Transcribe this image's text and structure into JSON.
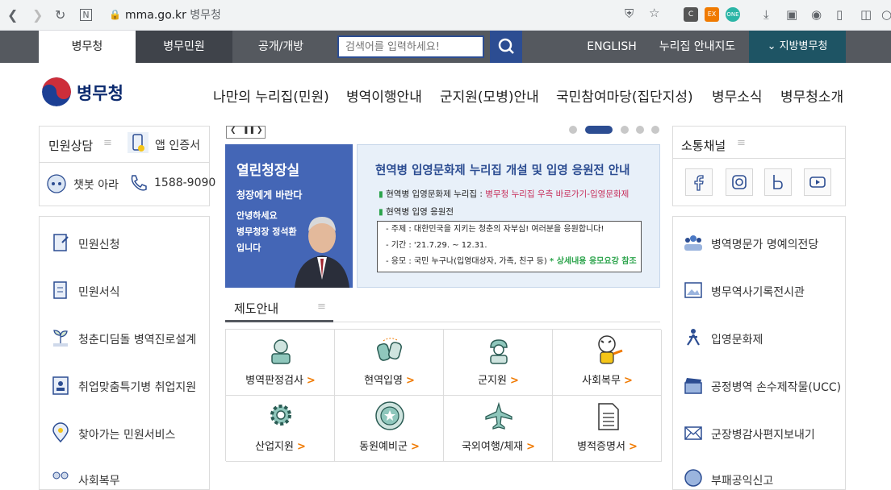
{
  "browser": {
    "domain": "mma.go.kr",
    "title": "병무청",
    "ext_labels": [
      "C",
      "EX",
      "ONE"
    ]
  },
  "topnav": {
    "tabs": [
      "병무청",
      "병무민원",
      "공개/개방"
    ],
    "search_placeholder": "검색어를 입력하세요!",
    "right_links": [
      "ENGLISH",
      "누리집 안내지도"
    ],
    "local_office": "지방병무청"
  },
  "header": {
    "logo": "병무청",
    "menu": [
      "나만의 누리집(민원)",
      "병역이행안내",
      "군지원(모병)안내",
      "국민참여마당(집단지성)",
      "병무소식",
      "병무청소개"
    ]
  },
  "left": {
    "title": "민원상담",
    "app_cert": "앱 인증서",
    "chatbot": "챗봇 아라",
    "phone": "1588-9090",
    "items": [
      "민원신청",
      "민원서식",
      "청춘디딤돌 병역진로설계",
      "취업맞춤특기병 취업지원",
      "찾아가는 민원서비스",
      "사회복무"
    ]
  },
  "banner": {
    "left_title": "열린청장실",
    "left_sub": "청장에게 바란다",
    "left_lines": [
      "안녕하세요",
      "병무청장 정석환",
      "입니다"
    ],
    "right_title": "현역병 입영문화제 누리집 개설 및 입영 응원전 안내",
    "bullet1_label": "현역병 입영문화제 누리집 : ",
    "bullet1_value": "병무청 누리집 우측 바로가기-입영문화제",
    "bullet2": "현역병 입영 응원전",
    "box_lines": [
      "- 주제 : 대한민국을 지키는 청춘의 자부심! 여러분을 응원합니다!",
      "- 기간 : '21.7.29. ~ 12.31.",
      "- 응모 : 국민 누구나(입영대상자, 가족, 친구 등)"
    ],
    "box_note": "* 상세내용 응모요강 참조"
  },
  "system": {
    "tab_label": "제도안내",
    "cells": [
      "병역판정검사",
      "현역입영",
      "군지원",
      "사회복무",
      "산업지원",
      "동원예비군",
      "국외여행/체재",
      "병적증명서"
    ]
  },
  "right": {
    "title": "소통채널",
    "social": [
      "facebook",
      "instagram",
      "blog",
      "youtube"
    ],
    "items": [
      "병역명문가 명예의전당",
      "병무역사기록전시관",
      "입영문화제",
      "공정병역 손수제작물(UCC)",
      "군장병감사편지보내기",
      "부패공익신고"
    ]
  },
  "colors": {
    "nav_bg": "#55595f",
    "brand_blue": "#2c4d92",
    "local_bg": "#1e5464",
    "banner_blue": "#4466b6",
    "accent_orange": "#f07a00"
  }
}
